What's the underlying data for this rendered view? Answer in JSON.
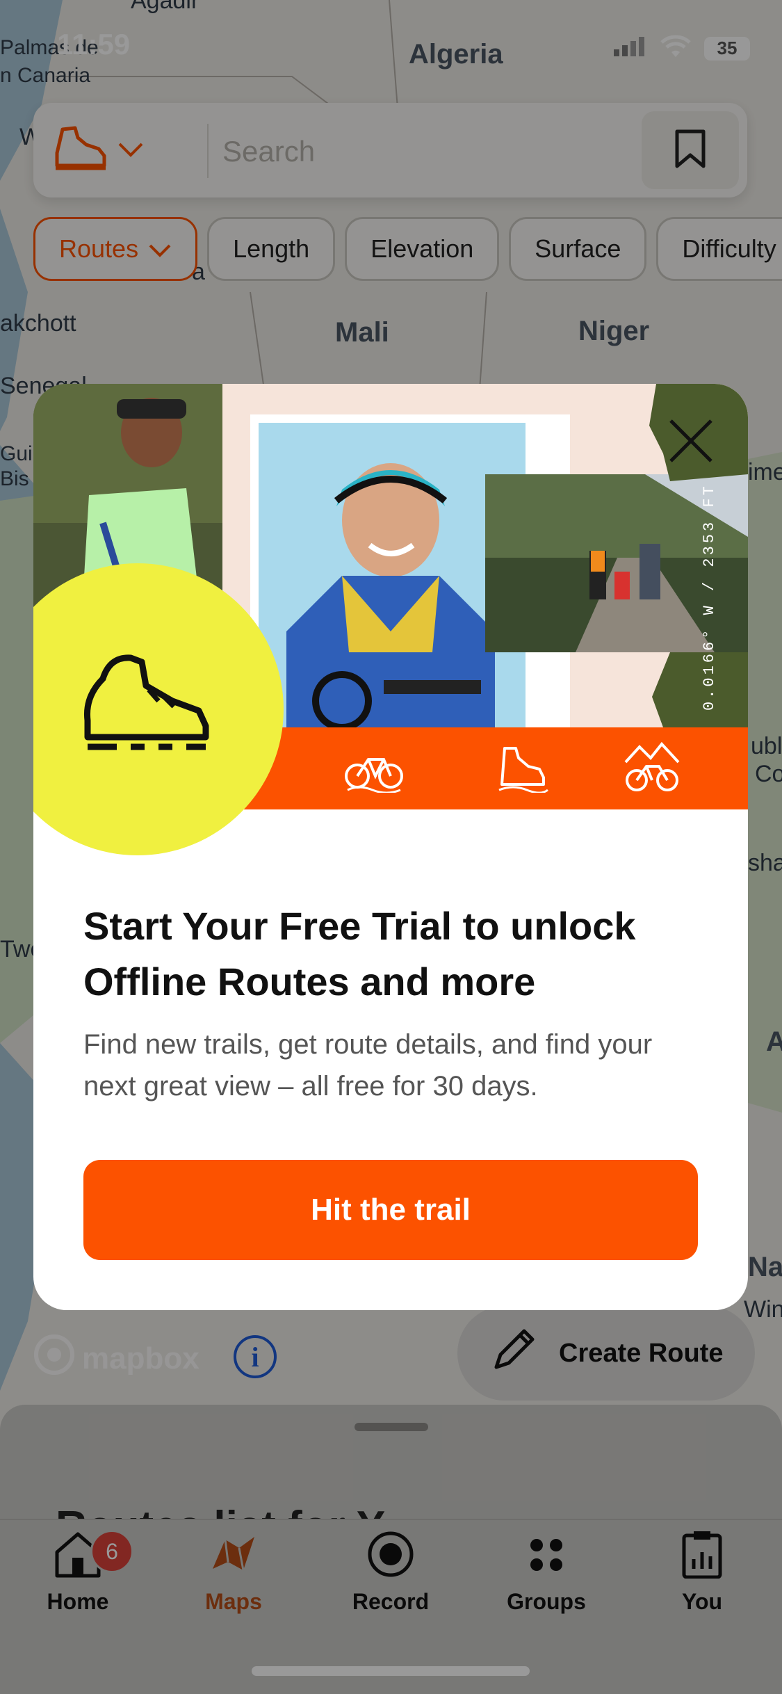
{
  "status_bar": {
    "time": "11:59",
    "battery": "35"
  },
  "map": {
    "labels": [
      "Agadir",
      "Palmas de",
      "n Canaria",
      "Algeria",
      "W",
      "a",
      "akchott",
      "Mali",
      "Niger",
      "Senegal",
      "Guin",
      "Bis",
      "Two",
      "ime",
      "ubl",
      "Co",
      "shas",
      "A",
      "Na",
      "Win"
    ]
  },
  "search": {
    "placeholder": "Search"
  },
  "filters": [
    {
      "label": "Routes"
    },
    {
      "label": "Length"
    },
    {
      "label": "Elevation"
    },
    {
      "label": "Surface"
    },
    {
      "label": "Difficulty"
    }
  ],
  "modal": {
    "coordinate_text": "0.0166° W / 2353 FT",
    "title": "Start Your Free Trial to unlock Offline Routes and more",
    "body": "Find new trails, get route details, and find your next great view – all free for 30 days.",
    "cta": "Hit the trail"
  },
  "map_controls": {
    "attribution": "mapbox",
    "create_route": "Create Route"
  },
  "sheet": {
    "title_partial": "Routes list for Y"
  },
  "tabs": [
    {
      "label": "Home",
      "badge": "6"
    },
    {
      "label": "Maps"
    },
    {
      "label": "Record"
    },
    {
      "label": "Groups"
    },
    {
      "label": "You"
    }
  ],
  "colors": {
    "accent": "#fc5200",
    "yellow": "#f0f040",
    "dark_green": "#4a5a2e"
  }
}
